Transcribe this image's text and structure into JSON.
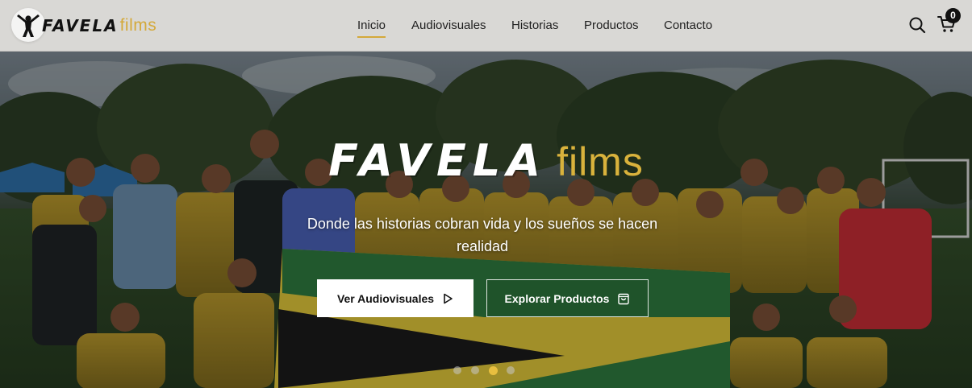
{
  "brand": {
    "word": "FAVELA",
    "films": "films"
  },
  "nav": {
    "items": [
      {
        "label": "Inicio",
        "active": true
      },
      {
        "label": "Audiovisuales",
        "active": false
      },
      {
        "label": "Historias",
        "active": false
      },
      {
        "label": "Productos",
        "active": false
      },
      {
        "label": "Contacto",
        "active": false
      }
    ]
  },
  "header_actions": {
    "search_icon": "search-icon",
    "cart_icon": "cart-icon",
    "cart_count": "0"
  },
  "hero": {
    "title_word": "FAVELA",
    "title_films": "films",
    "subtitle": "Donde las historias cobran vida y los sueños se hacen realidad",
    "primary_button": "Ver Audiovisuales",
    "primary_icon": "play-icon",
    "secondary_button": "Explorar Productos",
    "secondary_icon": "shopping-bag-icon",
    "slides_total": 4,
    "active_slide": 3
  },
  "colors": {
    "accent": "#d4a93a",
    "header_bg": "#d9d8d5",
    "text_dark": "#1e1e1e"
  }
}
